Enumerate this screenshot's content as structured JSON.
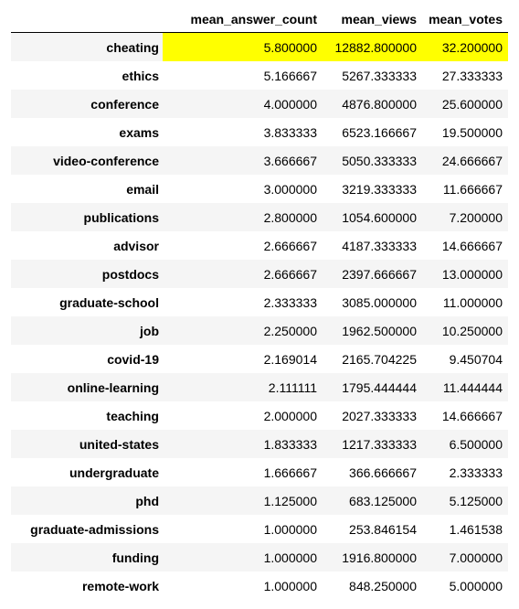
{
  "highlight_color": "#ffff00",
  "table": {
    "columns": [
      "mean_answer_count",
      "mean_views",
      "mean_votes"
    ],
    "highlighted_row": 0,
    "rows": [
      {
        "index": "cheating",
        "mean_answer_count": "5.800000",
        "mean_views": "12882.800000",
        "mean_votes": "32.200000"
      },
      {
        "index": "ethics",
        "mean_answer_count": "5.166667",
        "mean_views": "5267.333333",
        "mean_votes": "27.333333"
      },
      {
        "index": "conference",
        "mean_answer_count": "4.000000",
        "mean_views": "4876.800000",
        "mean_votes": "25.600000"
      },
      {
        "index": "exams",
        "mean_answer_count": "3.833333",
        "mean_views": "6523.166667",
        "mean_votes": "19.500000"
      },
      {
        "index": "video-conference",
        "mean_answer_count": "3.666667",
        "mean_views": "5050.333333",
        "mean_votes": "24.666667"
      },
      {
        "index": "email",
        "mean_answer_count": "3.000000",
        "mean_views": "3219.333333",
        "mean_votes": "11.666667"
      },
      {
        "index": "publications",
        "mean_answer_count": "2.800000",
        "mean_views": "1054.600000",
        "mean_votes": "7.200000"
      },
      {
        "index": "advisor",
        "mean_answer_count": "2.666667",
        "mean_views": "4187.333333",
        "mean_votes": "14.666667"
      },
      {
        "index": "postdocs",
        "mean_answer_count": "2.666667",
        "mean_views": "2397.666667",
        "mean_votes": "13.000000"
      },
      {
        "index": "graduate-school",
        "mean_answer_count": "2.333333",
        "mean_views": "3085.000000",
        "mean_votes": "11.000000"
      },
      {
        "index": "job",
        "mean_answer_count": "2.250000",
        "mean_views": "1962.500000",
        "mean_votes": "10.250000"
      },
      {
        "index": "covid-19",
        "mean_answer_count": "2.169014",
        "mean_views": "2165.704225",
        "mean_votes": "9.450704"
      },
      {
        "index": "online-learning",
        "mean_answer_count": "2.111111",
        "mean_views": "1795.444444",
        "mean_votes": "11.444444"
      },
      {
        "index": "teaching",
        "mean_answer_count": "2.000000",
        "mean_views": "2027.333333",
        "mean_votes": "14.666667"
      },
      {
        "index": "united-states",
        "mean_answer_count": "1.833333",
        "mean_views": "1217.333333",
        "mean_votes": "6.500000"
      },
      {
        "index": "undergraduate",
        "mean_answer_count": "1.666667",
        "mean_views": "366.666667",
        "mean_votes": "2.333333"
      },
      {
        "index": "phd",
        "mean_answer_count": "1.125000",
        "mean_views": "683.125000",
        "mean_votes": "5.125000"
      },
      {
        "index": "graduate-admissions",
        "mean_answer_count": "1.000000",
        "mean_views": "253.846154",
        "mean_votes": "1.461538"
      },
      {
        "index": "funding",
        "mean_answer_count": "1.000000",
        "mean_views": "1916.800000",
        "mean_votes": "7.000000"
      },
      {
        "index": "remote-work",
        "mean_answer_count": "1.000000",
        "mean_views": "848.250000",
        "mean_votes": "5.000000"
      }
    ]
  }
}
